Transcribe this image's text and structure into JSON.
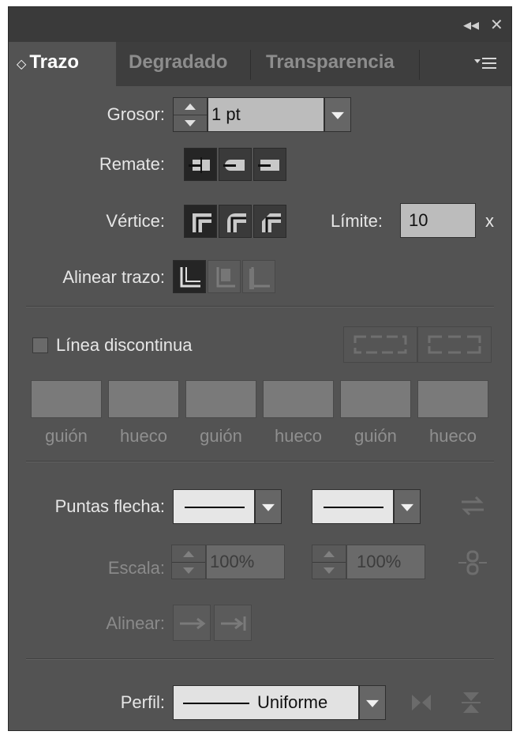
{
  "window": {
    "collapse_glyph": "◂◂",
    "close_glyph": "✕"
  },
  "tabs": [
    {
      "label": "Trazo",
      "active": true,
      "sort_glyph": "◇"
    },
    {
      "label": "Degradado",
      "active": false
    },
    {
      "label": "Transparencia",
      "active": false
    }
  ],
  "panel_menu_icon": "panel-menu-icon",
  "stroke": {
    "weight_label": "Grosor:",
    "weight_value": "1 pt",
    "cap_label": "Remate:",
    "corner_label": "Vértice:",
    "limit_label": "Límite:",
    "limit_value": "10",
    "limit_unit": "x",
    "align_label": "Alinear trazo:"
  },
  "dash": {
    "checkbox_label": "Línea discontinua",
    "checked": false,
    "fields": [
      {
        "label": "guión",
        "value": ""
      },
      {
        "label": "hueco",
        "value": ""
      },
      {
        "label": "guión",
        "value": ""
      },
      {
        "label": "hueco",
        "value": ""
      },
      {
        "label": "guión",
        "value": ""
      },
      {
        "label": "hueco",
        "value": ""
      }
    ]
  },
  "arrowheads": {
    "label": "Puntas flecha:",
    "scale_label": "Escala:",
    "scale_start": "100%",
    "scale_end": "100%",
    "align_label": "Alinear:"
  },
  "profile": {
    "label": "Perfil:",
    "value": "Uniforme"
  },
  "colors": {
    "panel_bg": "#535353",
    "field_bg": "#bcbcbc",
    "tab_bar_bg": "#3e3e3e"
  }
}
